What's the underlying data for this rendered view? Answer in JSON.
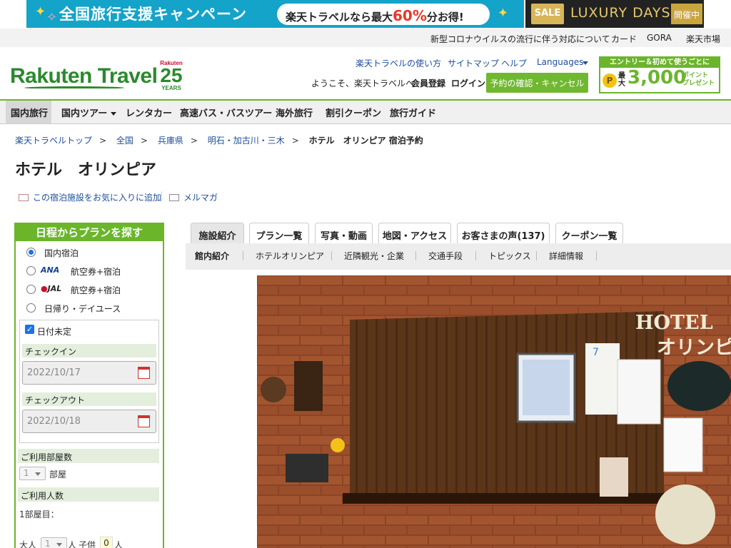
{
  "banners": {
    "campaign_title": "全国旅行支援キャンペーン",
    "campaign_pill_prefix": "楽天トラベルなら最大",
    "campaign_pill_pct": "60%",
    "campaign_pill_suffix": "分お得!",
    "sale_badge": "SALE",
    "luxury_title": "LUXURY DAYS",
    "luxury_open": "開催中"
  },
  "util_links": [
    "新型コロナウイルスの流行に伴う対応について",
    "カード",
    "GORA",
    "楽天市場"
  ],
  "header": {
    "logo": "Rakuten Travel",
    "badge_top": "Rakuten",
    "badge_num": "25",
    "badge_years": "YEARS",
    "links": [
      "楽天トラベルの使い方",
      "サイトマップ",
      "ヘルプ",
      "Languages"
    ],
    "welcome": "ようこそ、楽天トラベルへ",
    "register": "会員登録",
    "login": "ログイン",
    "confirm_button": "予約の確認・キャンセル",
    "promo_top": "エントリー＆初めて使うごとに",
    "promo_coin": "P",
    "promo_max_1": "最",
    "promo_max_2": "大",
    "promo_big": "3,000",
    "promo_pt_1": "ポイント",
    "promo_pt_2": "プレゼント"
  },
  "nav": [
    "国内旅行",
    "国内ツアー",
    "レンタカー",
    "高速バス・バスツアー",
    "海外旅行",
    "割引クーポン",
    "旅行ガイド"
  ],
  "breadcrumb": [
    "楽天トラベルトップ",
    "全国",
    "兵庫県",
    "明石・加古川・三木",
    "ホテル　オリンピア 宿泊予約"
  ],
  "breadcrumb_sep": ">",
  "page_title": "ホテル　オリンピア",
  "actions": {
    "favorite": "この宿泊施設をお気に入りに追加",
    "mail": "メルマガ"
  },
  "search_panel": {
    "title": "日程からプランを探す",
    "options": [
      "国内宿泊",
      "航空券+宿泊",
      "航空券+宿泊",
      "日帰り・デイユース"
    ],
    "ana": "ANA",
    "jal": "JAL",
    "date_undecided": "日付未定",
    "checkin_label": "チェックイン",
    "checkin_value": "2022/10/17",
    "checkout_label": "チェックアウト",
    "checkout_value": "2022/10/18",
    "rooms_label": "ご利用部屋数",
    "rooms_value": "1",
    "rooms_unit": "部屋",
    "people_label": "ご利用人数",
    "room1_label": "1部屋目：",
    "adult_label": "大人",
    "adult_value": "1",
    "adult_unit": "人",
    "child_label": "子供",
    "child_value": "0",
    "child_unit": "人"
  },
  "tabs": [
    "施設紹介",
    "プラン一覧",
    "写真・動画",
    "地図・アクセス",
    "お客さまの声(137)",
    "クーポン一覧"
  ],
  "subtabs": [
    "館内紹介",
    "ホテルオリンピア",
    "近隣観光・企業",
    "交通手段",
    "トピックス",
    "詳細情報"
  ],
  "photo": {
    "sign_line1": "HOTEL",
    "sign_line2": "オリンピ",
    "calendar_num": "7"
  },
  "colors": {
    "brand_green": "#6bb52b",
    "link_blue": "#1d4e9c",
    "campaign_cyan": "#14a3c9",
    "accent_red": "#c8102e"
  }
}
